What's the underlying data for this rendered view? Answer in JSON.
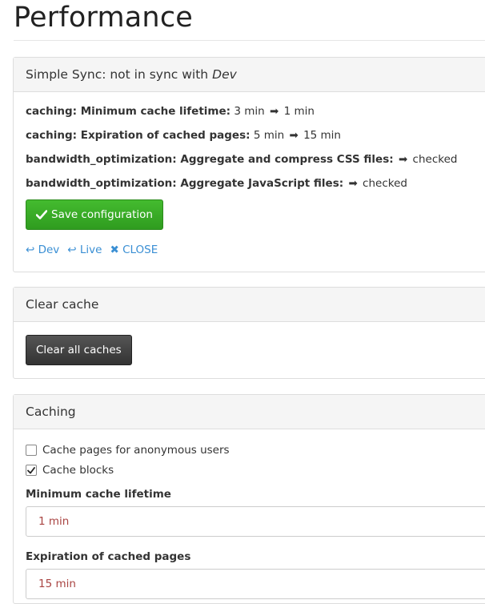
{
  "page": {
    "title": "Performance"
  },
  "sync_panel": {
    "heading_prefix": "Simple Sync: not in sync with",
    "heading_env": "Dev",
    "lines": [
      {
        "label": "caching: Minimum cache lifetime:",
        "old": "3 min",
        "new": "1 min"
      },
      {
        "label": "caching: Expiration of cached pages:",
        "old": "5 min",
        "new": "15 min"
      },
      {
        "label": "bandwidth_optimization: Aggregate and compress CSS files:",
        "old": "",
        "new": "checked"
      },
      {
        "label": "bandwidth_optimization: Aggregate JavaScript files:",
        "old": "",
        "new": "checked"
      }
    ],
    "arrow": "➡",
    "save_label": "Save configuration",
    "links": {
      "dev": "↩ Dev",
      "live": "↩ Live",
      "close": "✖ CLOSE"
    }
  },
  "clear_panel": {
    "heading": "Clear cache",
    "button_label": "Clear all caches"
  },
  "caching_panel": {
    "heading": "Caching",
    "checkboxes": [
      {
        "label": "Cache pages for anonymous users",
        "checked": false
      },
      {
        "label": "Cache blocks",
        "checked": true
      }
    ],
    "min_lifetime_label": "Minimum cache lifetime",
    "min_lifetime_value": "1 min",
    "expiration_label": "Expiration of cached pages",
    "expiration_value": "15 min"
  },
  "colors": {
    "save_button": "#37a824",
    "clear_button": "#444444",
    "link": "#3a8fd4",
    "field_value": "#a94442"
  },
  "icons": {
    "save": "check-icon",
    "checked": "checkmark-icon"
  }
}
